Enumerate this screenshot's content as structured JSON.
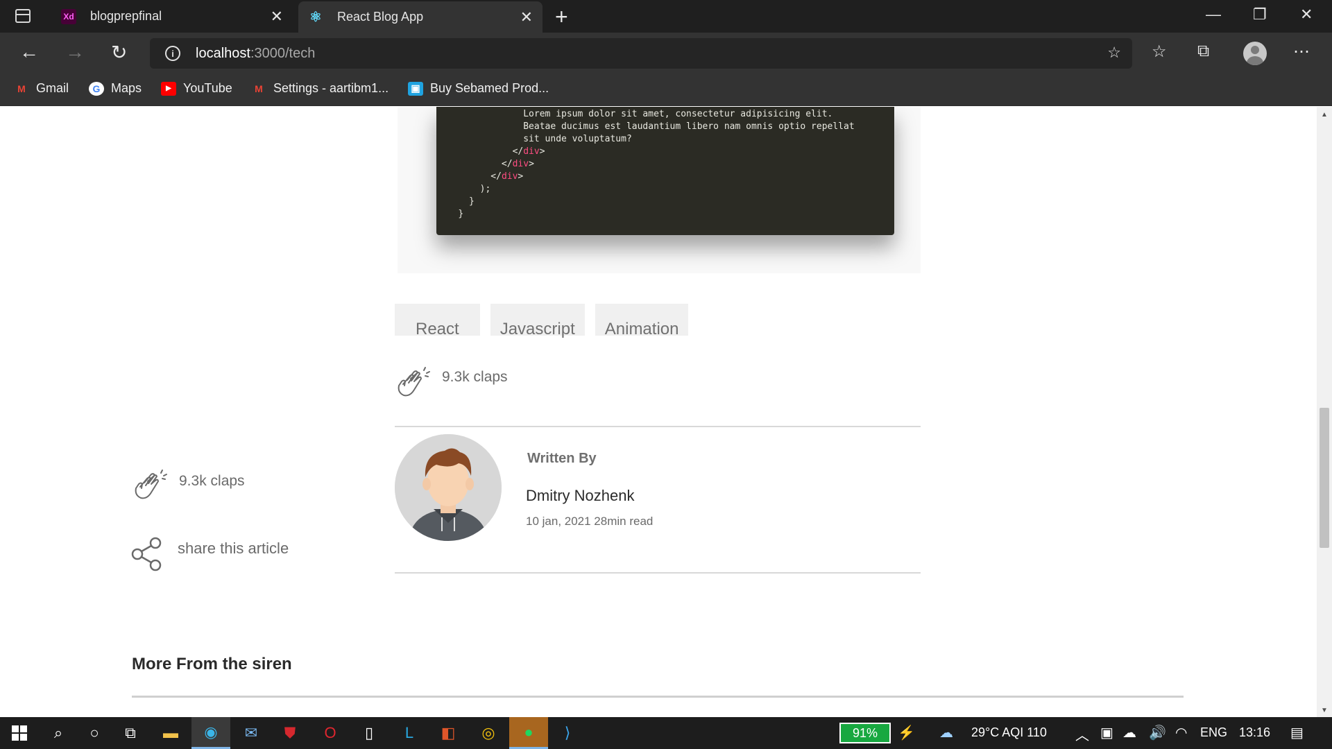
{
  "browser": {
    "tabs": [
      {
        "title": "blogprepfinal",
        "favicon": "xd-icon",
        "favicon_text": "Xd",
        "close": "✕"
      },
      {
        "title": "React Blog App",
        "favicon": "react-icon",
        "favicon_text": "⚛",
        "close": "✕"
      }
    ],
    "new_tab": "+",
    "window_controls": {
      "minimize": "—",
      "restore": "❐",
      "close": "✕"
    },
    "address": {
      "host": "localhost",
      "path": ":3000/tech"
    },
    "bookmarks": [
      {
        "label": "Gmail",
        "icon": "gmail-icon",
        "icon_text": "M",
        "color": "#ea4335"
      },
      {
        "label": "Maps",
        "icon": "google-icon",
        "icon_text": "G",
        "color": "#4285f4"
      },
      {
        "label": "YouTube",
        "icon": "youtube-icon",
        "icon_text": "▶",
        "color": "#ff0000"
      },
      {
        "label": "Settings - aartibm1...",
        "icon": "gmail-icon",
        "icon_text": "M",
        "color": "#ea4335"
      },
      {
        "label": "Buy Sebamed Prod...",
        "icon": "store-icon",
        "icon_text": "▣",
        "color": "#1fa3e0"
      }
    ]
  },
  "article": {
    "code_lines": [
      {
        "indent": "                ",
        "text": "Lorem ipsum dolor sit amet, consectetur adipisicing elit.",
        "kind": "text"
      },
      {
        "indent": "                ",
        "text": "Beatae ducimus est laudantium libero nam omnis optio repellat",
        "kind": "text"
      },
      {
        "indent": "                ",
        "text": "sit unde voluptatum?",
        "kind": "text"
      },
      {
        "indent": "              ",
        "open": "</",
        "name": "div",
        "close": ">",
        "kind": "tag"
      },
      {
        "indent": "            ",
        "open": "</",
        "name": "div",
        "close": ">",
        "kind": "tag"
      },
      {
        "indent": "          ",
        "open": "</",
        "name": "div",
        "close": ">",
        "kind": "tag"
      },
      {
        "indent": "        ",
        "text": ");",
        "kind": "text"
      },
      {
        "indent": "      ",
        "text": "}",
        "kind": "text"
      },
      {
        "indent": "    ",
        "text": "}",
        "kind": "text"
      }
    ],
    "tags": [
      "React",
      "Javascript",
      "Animation"
    ],
    "claps": "9.3k claps",
    "written_by": "Written By",
    "author": "Dmitry Nozhenk",
    "meta": "10 jan, 2021 28min read",
    "side_claps": "9.3k claps",
    "share": "share this article",
    "more_title": "More From the siren"
  },
  "taskbar": {
    "battery": "91%",
    "weather": "29°C AQI 110",
    "language": "ENG",
    "time": "13:16"
  },
  "colors": {
    "tag_color": "#ff4d82",
    "code_bg": "#2b2b24",
    "chrome_dark": "#1f1f1f"
  }
}
